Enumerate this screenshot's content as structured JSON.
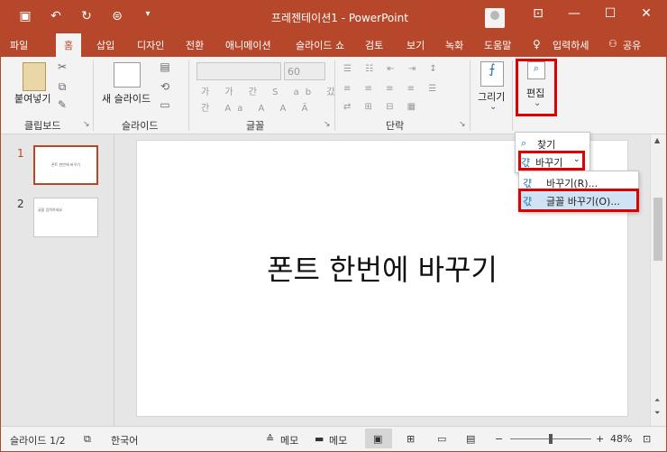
{
  "window": {
    "title": "프레젠테이션1 - PowerPoint"
  },
  "qat": {
    "save_icon": "save-icon",
    "undo_icon": "undo-icon",
    "redo_icon": "redo-icon",
    "present_icon": "present-icon",
    "customize_icon": "customize-icon"
  },
  "tabs": [
    {
      "label": "파일"
    },
    {
      "label": "홈"
    },
    {
      "label": "삽입"
    },
    {
      "label": "디자인"
    },
    {
      "label": "전환"
    },
    {
      "label": "애니메이션"
    },
    {
      "label": "슬라이드 쇼"
    },
    {
      "label": "검토"
    },
    {
      "label": "보기"
    },
    {
      "label": "녹화"
    },
    {
      "label": "도움말"
    }
  ],
  "tell_me": "입력하세",
  "share": "공유",
  "ribbon": {
    "paste": "붙여넣기",
    "new_slide": "새 슬라이드",
    "groups": {
      "clipboard": "클립보드",
      "slides": "슬라이드",
      "font": "글꼴",
      "paragraph": "단락"
    },
    "font_size": "60",
    "draw": "그리기",
    "edit": "편집"
  },
  "edit_menu": {
    "find": "찾기",
    "replace": "바꾸기",
    "replace_sub": "바꾸기(R)...",
    "replace_font": "글꼴 바꾸기(O)..."
  },
  "slides": [
    {
      "number": "1",
      "text": "폰트 한번에 바꾸기"
    },
    {
      "number": "2",
      "text": "글을 입력하세요"
    }
  ],
  "slide_title": "폰트 한번에 바꾸기",
  "status": {
    "slide_count": "슬라이드 1/2",
    "language": "한국어",
    "notes": "메모",
    "comments": "메모",
    "zoom": "48%"
  },
  "colors": {
    "accent": "#b7472a",
    "highlight": "#e00000"
  }
}
